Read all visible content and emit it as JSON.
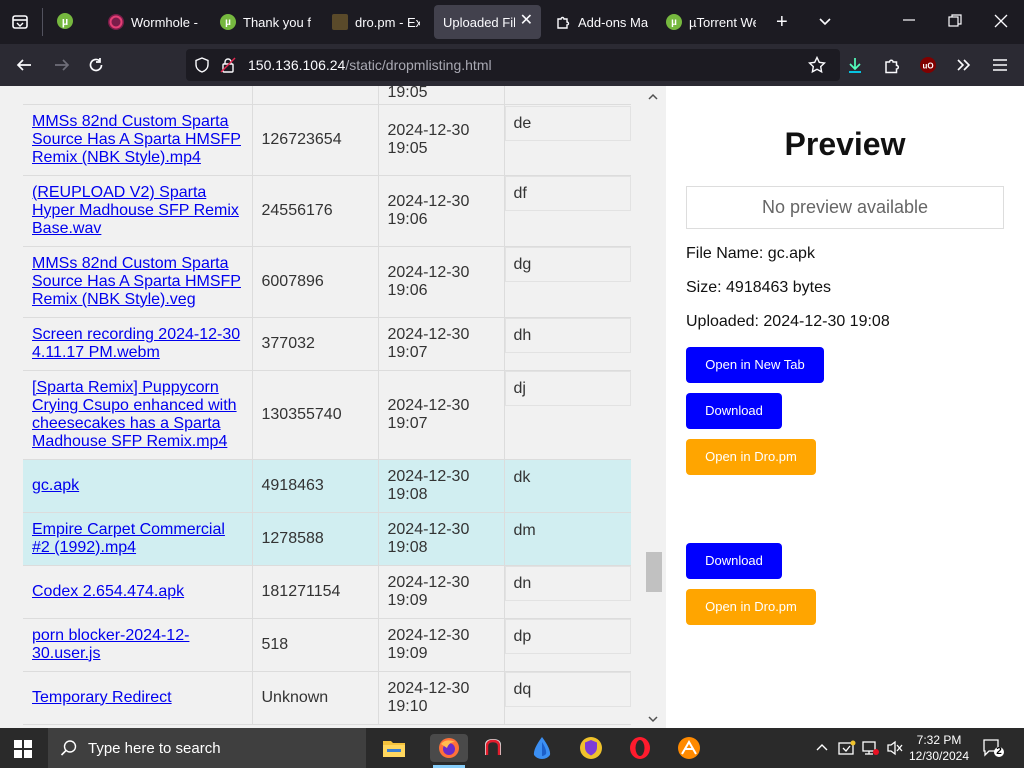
{
  "tabs": [
    {
      "title": "Wormhole -",
      "icon": "wormhole-icon"
    },
    {
      "title": "Thank you f",
      "icon": "utorrent-icon"
    },
    {
      "title": "dro.pm - Ext",
      "icon": "dro-icon"
    },
    {
      "title": "Uploaded File",
      "icon": "none"
    },
    {
      "title": "Add-ons Ma",
      "icon": "puzzle-icon"
    },
    {
      "title": "µTorrent We",
      "icon": "utorrent-icon"
    }
  ],
  "address": {
    "host": "150.136.106.24",
    "path": "/static/dropmlisting.html"
  },
  "files": [
    {
      "name": "",
      "size": "",
      "date": "19:05",
      "code": "",
      "partial": true
    },
    {
      "name": "MMSs 82nd Custom Sparta Source Has A Sparta HMSFP Remix (NBK Style).mp4",
      "size": "126723654",
      "date": "2024-12-30 19:05",
      "code": "de"
    },
    {
      "name": "(REUPLOAD V2) Sparta Hyper Madhouse SFP Remix Base.wav",
      "size": "24556176",
      "date": "2024-12-30 19:06",
      "code": "df"
    },
    {
      "name": "MMSs 82nd Custom Sparta Source Has A Sparta HMSFP Remix (NBK Style).veg",
      "size": "6007896",
      "date": "2024-12-30 19:06",
      "code": "dg"
    },
    {
      "name": "Screen recording 2024-12-30 4.11.17 PM.webm",
      "size": "377032",
      "date": "2024-12-30 19:07",
      "code": "dh"
    },
    {
      "name": "[Sparta Remix] Puppycorn Crying Csupo enhanced with cheesecakes has a Sparta Madhouse SFP Remix.mp4",
      "size": "130355740",
      "date": "2024-12-30 19:07",
      "code": "dj"
    },
    {
      "name": "gc.apk",
      "size": "4918463",
      "date": "2024-12-30 19:08",
      "code": "dk",
      "highlight": true
    },
    {
      "name": "Empire Carpet Commercial #2 (1992).mp4",
      "size": "1278588",
      "date": "2024-12-30 19:08",
      "code": "dm",
      "highlight": true
    },
    {
      "name": "Codex 2.654.474.apk",
      "size": "181271154",
      "date": "2024-12-30 19:09",
      "code": "dn"
    },
    {
      "name": "porn blocker-2024-12-30.user.js",
      "size": "518",
      "date": "2024-12-30 19:09",
      "code": "dp"
    },
    {
      "name": "Temporary Redirect",
      "size": "Unknown",
      "date": "2024-12-30 19:10",
      "code": "dq"
    }
  ],
  "preview": {
    "title": "Preview",
    "no_preview": "No preview available",
    "file_name": "File Name: gc.apk",
    "size": "Size: 4918463 bytes",
    "uploaded": "Uploaded: 2024-12-30 19:08",
    "open_new_tab": "Open in New Tab",
    "download_1": "Download",
    "open_dro_1": "Open in Dro.pm",
    "download_2": "Download",
    "open_dro_2": "Open in Dro.pm"
  },
  "taskbar": {
    "search_placeholder": "Type here to search",
    "time": "7:32 PM",
    "date": "12/30/2024",
    "notification_count": "2"
  },
  "colors": {
    "link": "#0000ee",
    "highlight_row": "#d1eef1",
    "btn_blue": "#0000ff",
    "btn_orange": "#ffa500"
  }
}
